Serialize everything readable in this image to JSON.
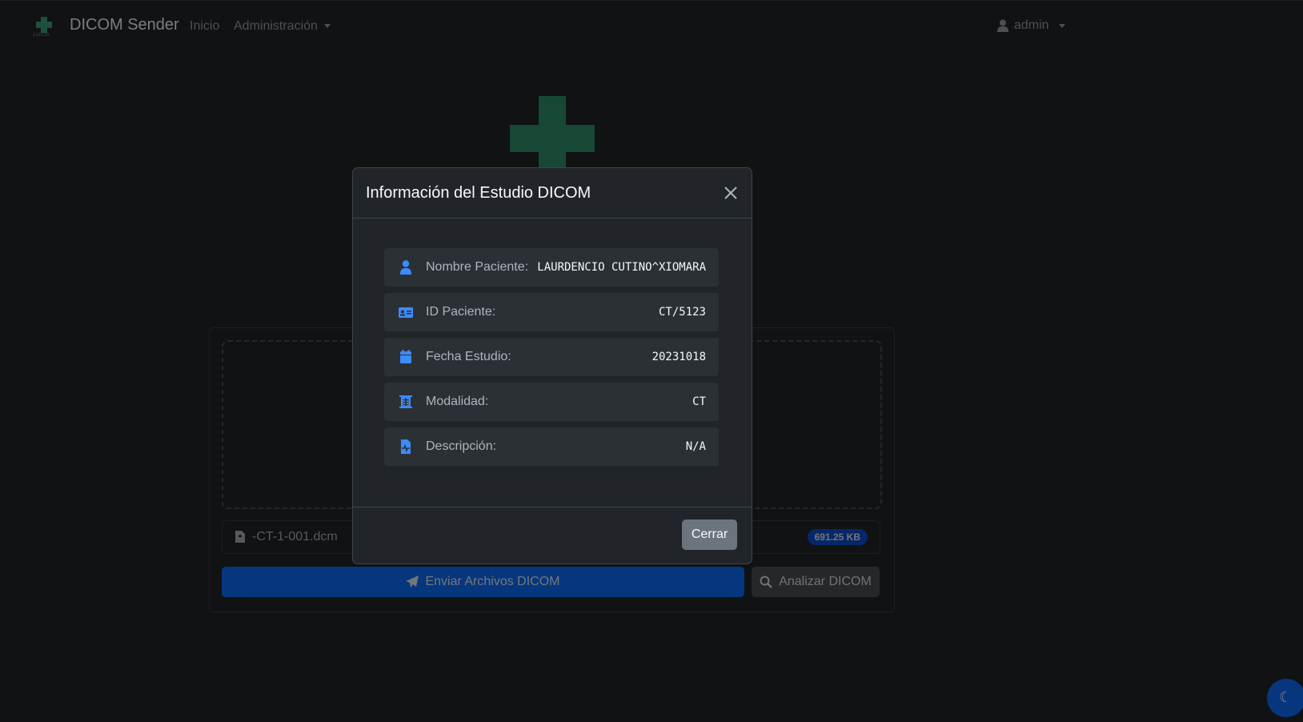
{
  "navbar": {
    "brand": "DICOM Sender",
    "brand_logo_text": "LUCIA",
    "links": [
      {
        "label": "Inicio"
      },
      {
        "label": "Administración"
      }
    ],
    "user": "admin"
  },
  "upload": {
    "file_name": "-CT-1-001.dcm",
    "file_size": "691.25 KB",
    "send_button": "Enviar Archivos DICOM",
    "analyze_button": "Analizar DICOM"
  },
  "modal": {
    "title": "Información del Estudio DICOM",
    "items": [
      {
        "icon": "user-icon",
        "label": "Nombre Paciente:",
        "value": "LAURDENCIO CUTINO^XIOMARA"
      },
      {
        "icon": "id-card-icon",
        "label": "ID Paciente:",
        "value": "CT/5123"
      },
      {
        "icon": "calendar-icon",
        "label": "Fecha Estudio:",
        "value": "20231018"
      },
      {
        "icon": "x-ray-icon",
        "label": "Modalidad:",
        "value": "CT"
      },
      {
        "icon": "file-medical-icon",
        "label": "Descripción:",
        "value": "N/A"
      }
    ],
    "close_button": "Cerrar"
  },
  "colors": {
    "accent": "#0d6efd",
    "brand_green": "#2f8f6b",
    "icon_blue": "#3d8bfd"
  }
}
